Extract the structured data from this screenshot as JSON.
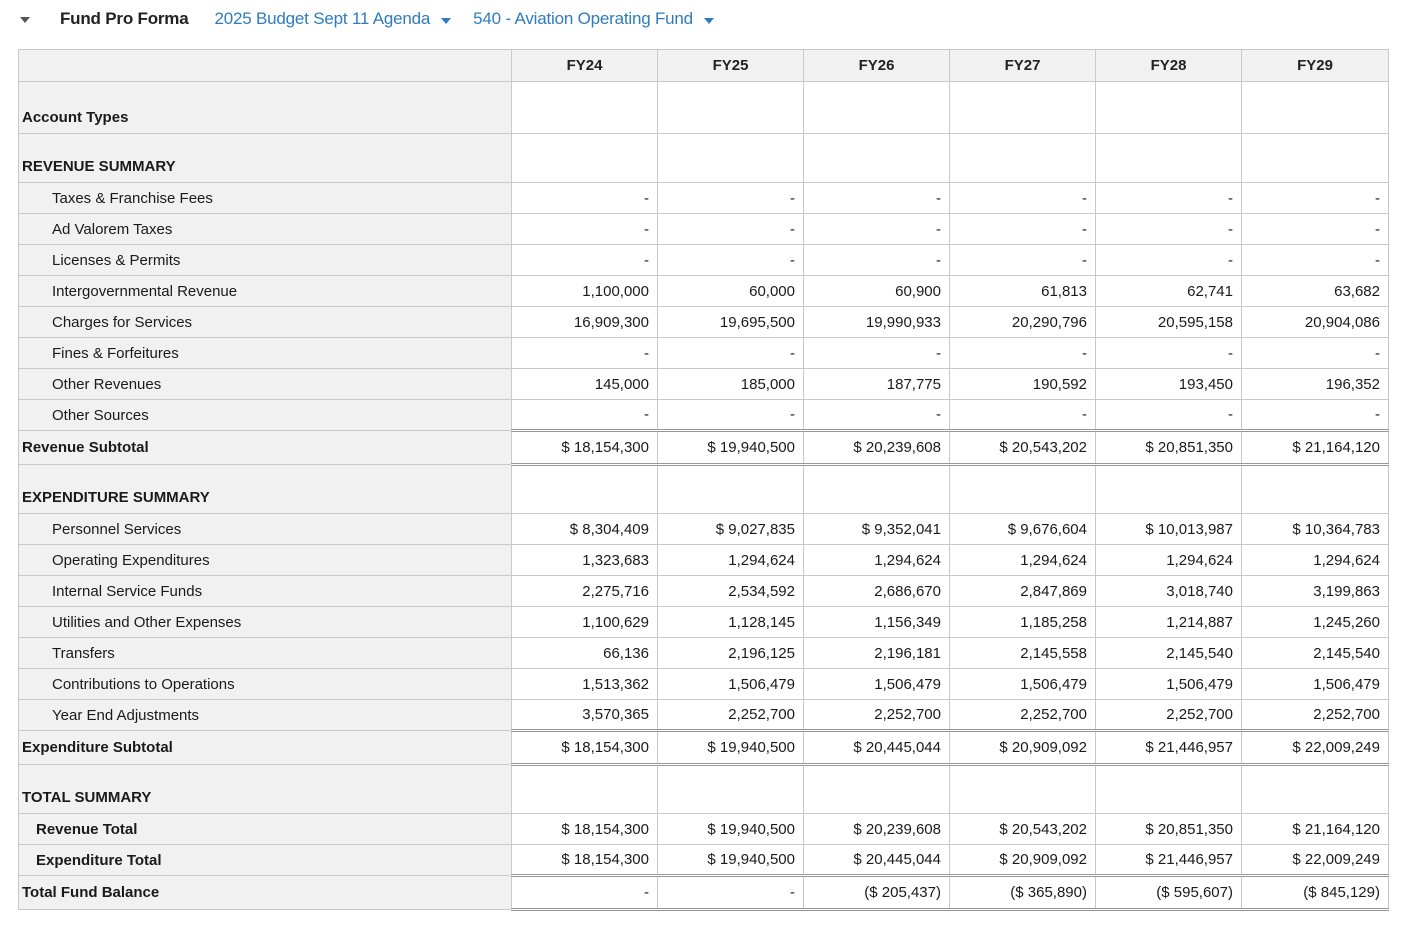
{
  "toolbar": {
    "title": "Fund Pro Forma",
    "budget_selector": "2025 Budget Sept 11 Agenda",
    "fund_selector": "540 - Aviation Operating Fund",
    "collapse_icon": "caret-down-icon",
    "dropdown_icon": "caret-down-icon",
    "link_color": "#2e7cbe"
  },
  "table": {
    "columns": [
      "FY24",
      "FY25",
      "FY26",
      "FY27",
      "FY28",
      "FY29"
    ],
    "rows": [
      {
        "type": "tall",
        "label": "Account Types",
        "values": [
          "",
          "",
          "",
          "",
          "",
          ""
        ]
      },
      {
        "type": "section",
        "label": "REVENUE SUMMARY",
        "values": [
          "",
          "",
          "",
          "",
          "",
          ""
        ]
      },
      {
        "type": "data",
        "label": "Taxes & Franchise Fees",
        "values": [
          "-",
          "-",
          "-",
          "-",
          "-",
          "-"
        ]
      },
      {
        "type": "data",
        "label": "Ad Valorem Taxes",
        "values": [
          "-",
          "-",
          "-",
          "-",
          "-",
          "-"
        ]
      },
      {
        "type": "data",
        "label": "Licenses & Permits",
        "values": [
          "-",
          "-",
          "-",
          "-",
          "-",
          "-"
        ]
      },
      {
        "type": "data",
        "label": "Intergovernmental Revenue",
        "values": [
          "1,100,000",
          "60,000",
          "60,900",
          "61,813",
          "62,741",
          "63,682"
        ]
      },
      {
        "type": "data",
        "label": "Charges for Services",
        "values": [
          "16,909,300",
          "19,695,500",
          "19,990,933",
          "20,290,796",
          "20,595,158",
          "20,904,086"
        ]
      },
      {
        "type": "data",
        "label": "Fines & Forfeitures",
        "values": [
          "-",
          "-",
          "-",
          "-",
          "-",
          "-"
        ]
      },
      {
        "type": "data",
        "label": "Other Revenues",
        "values": [
          "145,000",
          "185,000",
          "187,775",
          "190,592",
          "193,450",
          "196,352"
        ]
      },
      {
        "type": "data",
        "label": "Other Sources",
        "values": [
          "-",
          "-",
          "-",
          "-",
          "-",
          "-"
        ]
      },
      {
        "type": "subtotal",
        "label": "Revenue Subtotal",
        "values": [
          "$ 18,154,300",
          "$ 19,940,500",
          "$ 20,239,608",
          "$ 20,543,202",
          "$ 20,851,350",
          "$ 21,164,120"
        ]
      },
      {
        "type": "section",
        "label": "EXPENDITURE SUMMARY",
        "values": [
          "",
          "",
          "",
          "",
          "",
          ""
        ]
      },
      {
        "type": "data",
        "label": "Personnel Services",
        "values": [
          "$ 8,304,409",
          "$ 9,027,835",
          "$ 9,352,041",
          "$ 9,676,604",
          "$ 10,013,987",
          "$ 10,364,783"
        ]
      },
      {
        "type": "data",
        "label": "Operating Expenditures",
        "values": [
          "1,323,683",
          "1,294,624",
          "1,294,624",
          "1,294,624",
          "1,294,624",
          "1,294,624"
        ]
      },
      {
        "type": "data",
        "label": "Internal Service Funds",
        "values": [
          "2,275,716",
          "2,534,592",
          "2,686,670",
          "2,847,869",
          "3,018,740",
          "3,199,863"
        ]
      },
      {
        "type": "data",
        "label": "Utilities and Other Expenses",
        "values": [
          "1,100,629",
          "1,128,145",
          "1,156,349",
          "1,185,258",
          "1,214,887",
          "1,245,260"
        ]
      },
      {
        "type": "data",
        "label": "Transfers",
        "values": [
          "66,136",
          "2,196,125",
          "2,196,181",
          "2,145,558",
          "2,145,540",
          "2,145,540"
        ]
      },
      {
        "type": "data",
        "label": "Contributions to Operations",
        "values": [
          "1,513,362",
          "1,506,479",
          "1,506,479",
          "1,506,479",
          "1,506,479",
          "1,506,479"
        ]
      },
      {
        "type": "data",
        "label": "Year End Adjustments",
        "values": [
          "3,570,365",
          "2,252,700",
          "2,252,700",
          "2,252,700",
          "2,252,700",
          "2,252,700"
        ]
      },
      {
        "type": "subtotal",
        "label": "Expenditure Subtotal",
        "values": [
          "$ 18,154,300",
          "$ 19,940,500",
          "$ 20,445,044",
          "$ 20,909,092",
          "$ 21,446,957",
          "$ 22,009,249"
        ]
      },
      {
        "type": "section",
        "label": "TOTAL SUMMARY",
        "values": [
          "",
          "",
          "",
          "",
          "",
          ""
        ]
      },
      {
        "type": "total",
        "label": "Revenue Total",
        "values": [
          "$ 18,154,300",
          "$ 19,940,500",
          "$ 20,239,608",
          "$ 20,543,202",
          "$ 20,851,350",
          "$ 21,164,120"
        ]
      },
      {
        "type": "total",
        "label": "Expenditure Total",
        "values": [
          "$ 18,154,300",
          "$ 19,940,500",
          "$ 20,445,044",
          "$ 20,909,092",
          "$ 21,446,957",
          "$ 22,009,249"
        ]
      },
      {
        "type": "grand",
        "label": "Total Fund Balance",
        "values": [
          "-",
          "-",
          "($ 205,437)",
          "($ 365,890)",
          "($ 595,607)",
          "($ 845,129)"
        ]
      }
    ]
  }
}
